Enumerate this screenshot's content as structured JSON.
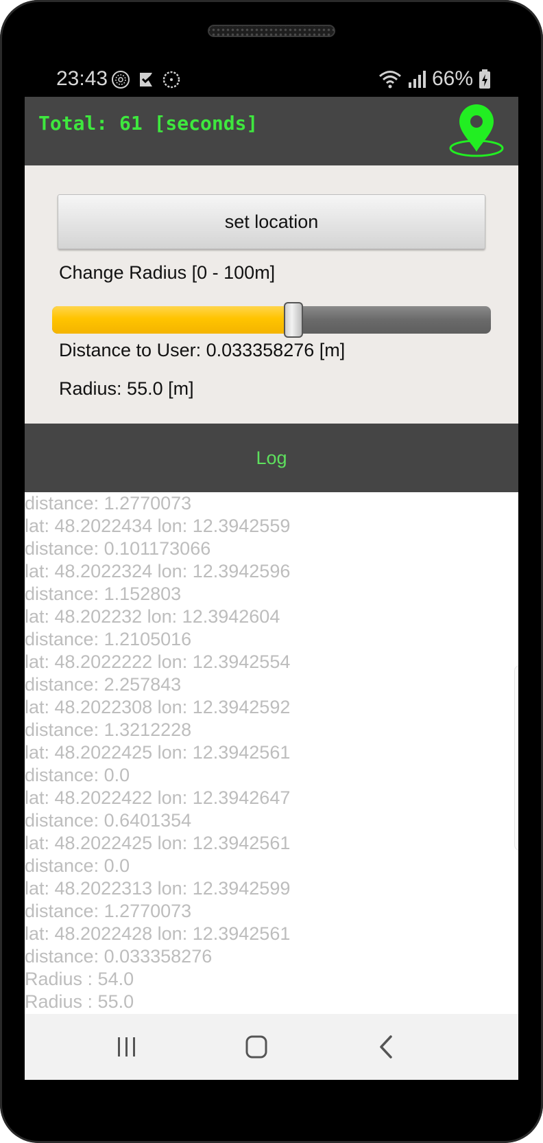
{
  "status_bar": {
    "time": "23:43",
    "left_icons": [
      "vpn-globe-icon",
      "checkbox-flag-icon",
      "circle-dots-icon"
    ],
    "battery": "66%",
    "right_icons": [
      "wifi-icon",
      "signal-icon",
      "battery-icon"
    ]
  },
  "app_bar": {
    "title": "Total: 61 [seconds]",
    "icon": "location-pin-icon",
    "accent": "#3ee83e"
  },
  "controls": {
    "button_label": "set location",
    "radius_label": "Change Radius [0 - 100m]",
    "slider": {
      "min": 0,
      "max": 100,
      "value": 55
    },
    "distance_text": "Distance to User: 0.033358276 [m]",
    "radius_text": "Radius: 55.0 [m]"
  },
  "log": {
    "header": "Log",
    "lines": [
      "distance: 1.2770073",
      "lat: 48.2022434 lon: 12.3942559",
      "distance: 0.101173066",
      "lat: 48.2022324 lon: 12.3942596",
      "distance: 1.152803",
      "lat: 48.202232 lon: 12.3942604",
      "distance: 1.2105016",
      "lat: 48.2022222 lon: 12.3942554",
      "distance: 2.257843",
      "lat: 48.2022308 lon: 12.3942592",
      "distance: 1.3212228",
      "lat: 48.2022425 lon: 12.3942561",
      "distance: 0.0",
      "lat: 48.2022422 lon: 12.3942647",
      "distance: 0.6401354",
      "lat: 48.2022425 lon: 12.3942561",
      "distance: 0.0",
      "lat: 48.2022313 lon: 12.3942599",
      "distance: 1.2770073",
      "lat: 48.2022428 lon: 12.3942561",
      "distance: 0.033358276",
      "Radius : 54.0",
      "Radius : 55.0"
    ]
  },
  "nav_bar": {
    "buttons": [
      "recents-icon",
      "home-icon",
      "back-icon"
    ]
  }
}
